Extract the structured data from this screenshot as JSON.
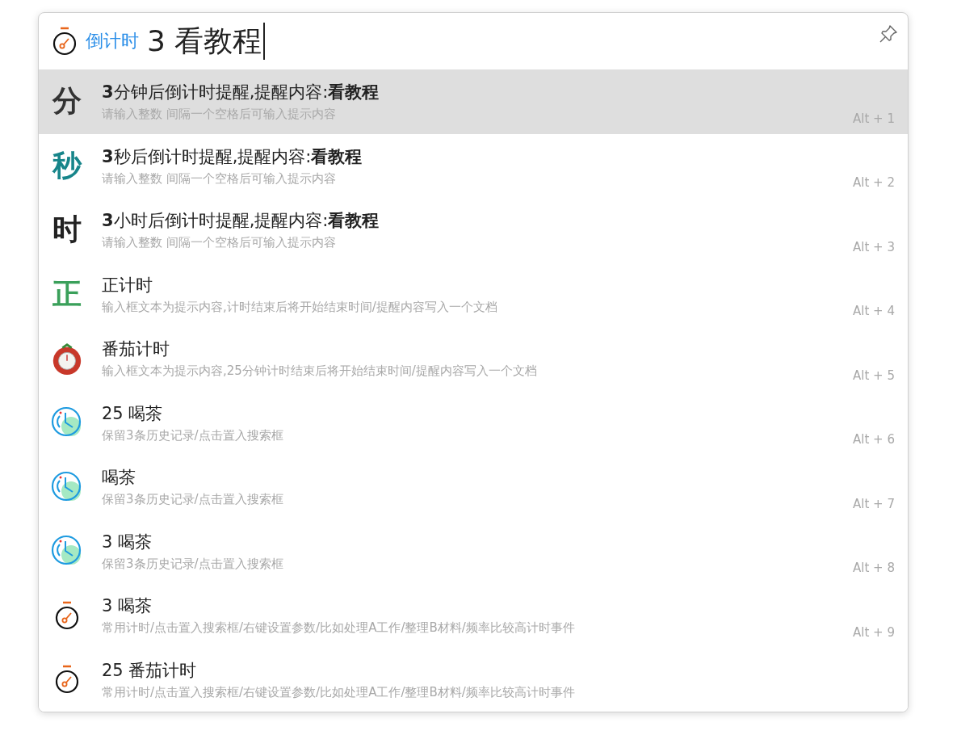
{
  "search": {
    "mode": "倒计时",
    "value": "3 看教程"
  },
  "results": [
    {
      "kind": "glyph",
      "glyph": "分",
      "color": "#333333",
      "title": "**3**分钟后倒计时提醒,提醒内容:**看教程**",
      "subtitle": "请输入整数 间隔一个空格后可输入提示内容",
      "shortcut": "Alt + 1",
      "selected": true
    },
    {
      "kind": "glyph",
      "glyph": "秒",
      "color": "#17858a",
      "title": "**3**秒后倒计时提醒,提醒内容:**看教程**",
      "subtitle": "请输入整数 间隔一个空格后可输入提示内容",
      "shortcut": "Alt + 2",
      "selected": false
    },
    {
      "kind": "glyph",
      "glyph": "时",
      "color": "#222222",
      "title": "**3**小时后倒计时提醒,提醒内容:**看教程**",
      "subtitle": "请输入整数 间隔一个空格后可输入提示内容",
      "shortcut": "Alt + 3",
      "selected": false
    },
    {
      "kind": "glyph",
      "glyph": "正",
      "color": "#3aa05a",
      "title": "正计时",
      "subtitle": "输入框文本为提示内容,计时结束后将开始结束时间/提醒内容写入一个文档",
      "shortcut": "Alt + 4",
      "selected": false
    },
    {
      "kind": "tomato",
      "title": "番茄计时",
      "subtitle": "输入框文本为提示内容,25分钟计时结束后将开始结束时间/提醒内容写入一个文档",
      "shortcut": "Alt + 5",
      "selected": false
    },
    {
      "kind": "clock",
      "title": "25 喝茶",
      "subtitle": "保留3条历史记录/点击置入搜索框",
      "shortcut": "Alt + 6",
      "selected": false
    },
    {
      "kind": "clock",
      "title": "喝茶",
      "subtitle": "保留3条历史记录/点击置入搜索框",
      "shortcut": "Alt + 7",
      "selected": false
    },
    {
      "kind": "clock",
      "title": "3 喝茶",
      "subtitle": "保留3条历史记录/点击置入搜索框",
      "shortcut": "Alt + 8",
      "selected": false
    },
    {
      "kind": "stopwatch",
      "title": "3 喝茶",
      "subtitle": "常用计时/点击置入搜索框/右键设置参数/比如处理A工作/整理B材料/频率比较高计时事件",
      "shortcut": "Alt + 9",
      "selected": false
    },
    {
      "kind": "stopwatch",
      "title": "25 番茄计时",
      "subtitle": "常用计时/点击置入搜索框/右键设置参数/比如处理A工作/整理B材料/频率比较高计时事件",
      "selected": false
    }
  ]
}
